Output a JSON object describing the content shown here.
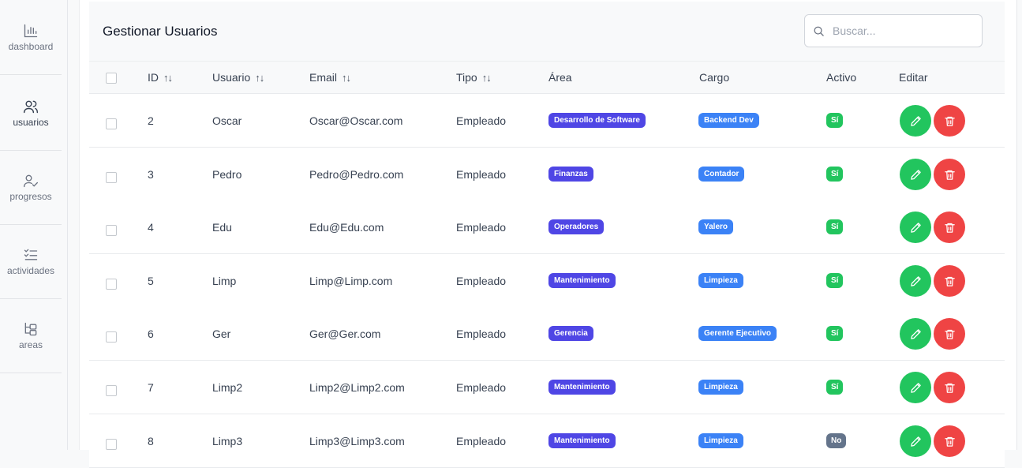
{
  "sidebar": {
    "items": [
      {
        "label": "dashboard",
        "icon": "bar-chart-icon"
      },
      {
        "label": "usuarios",
        "icon": "users-icon"
      },
      {
        "label": "progresos",
        "icon": "user-check-icon"
      },
      {
        "label": "actividades",
        "icon": "checklist-icon"
      },
      {
        "label": "areas",
        "icon": "hierarchy-icon"
      }
    ]
  },
  "header": {
    "title": "Gestionar Usuarios",
    "search_placeholder": "Buscar..."
  },
  "table": {
    "columns": {
      "id": "ID",
      "usuario": "Usuario",
      "email": "Email",
      "tipo": "Tipo",
      "area": "Área",
      "cargo": "Cargo",
      "activo": "Activo",
      "editar": "Editar"
    },
    "sort_glyph": "↑↓",
    "rows": [
      {
        "id": "2",
        "usuario": "Oscar",
        "email": "Oscar@Oscar.com",
        "tipo": "Empleado",
        "area": "Desarrollo de Software",
        "cargo": "Backend Dev",
        "activo": "Sí"
      },
      {
        "id": "3",
        "usuario": "Pedro",
        "email": "Pedro@Pedro.com",
        "tipo": "Empleado",
        "area": "Finanzas",
        "cargo": "Contador",
        "activo": "Sí"
      },
      {
        "id": "4",
        "usuario": "Edu",
        "email": "Edu@Edu.com",
        "tipo": "Empleado",
        "area": "Operadores",
        "cargo": "Yalero",
        "activo": "Sí"
      },
      {
        "id": "5",
        "usuario": "Limp",
        "email": "Limp@Limp.com",
        "tipo": "Empleado",
        "area": "Mantenimiento",
        "cargo": "Limpieza",
        "activo": "Sí"
      },
      {
        "id": "6",
        "usuario": "Ger",
        "email": "Ger@Ger.com",
        "tipo": "Empleado",
        "area": "Gerencia",
        "cargo": "Gerente Ejecutivo",
        "activo": "Sí"
      },
      {
        "id": "7",
        "usuario": "Limp2",
        "email": "Limp2@Limp2.com",
        "tipo": "Empleado",
        "area": "Mantenimiento",
        "cargo": "Limpieza",
        "activo": "Sí"
      },
      {
        "id": "8",
        "usuario": "Limp3",
        "email": "Limp3@Limp3.com",
        "tipo": "Empleado",
        "area": "Mantenimiento",
        "cargo": "Limpieza",
        "activo": "No"
      }
    ]
  },
  "colors": {
    "area_badge": "#4f46e5",
    "cargo_badge": "#3b82f6",
    "active_yes": "#22c55e",
    "active_no": "#64748b",
    "edit_button": "#22c55e",
    "delete_button": "#ef4444"
  }
}
